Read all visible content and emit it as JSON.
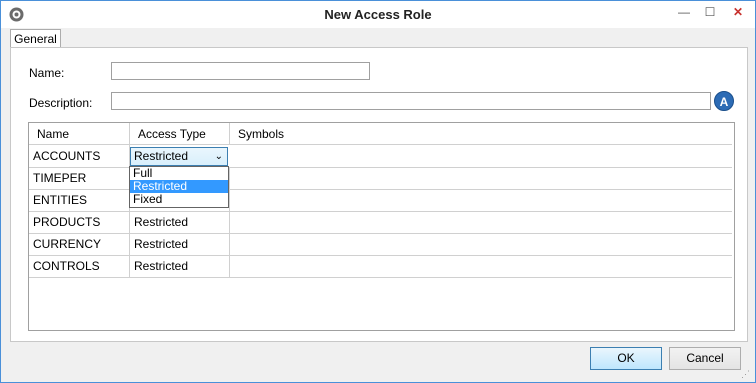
{
  "window": {
    "title": "New Access Role",
    "min_glyph": "—",
    "max_glyph": "☐",
    "close_glyph": "✕"
  },
  "tabs": [
    {
      "label": "General",
      "active": true
    }
  ],
  "form": {
    "name_label": "Name:",
    "name_value": "",
    "description_label": "Description:",
    "description_value": "",
    "description_button_glyph": "A"
  },
  "grid": {
    "columns": [
      "Name",
      "Access Type",
      "Symbols"
    ],
    "rows": [
      {
        "name": "ACCOUNTS",
        "access_type": "Restricted",
        "symbols": ""
      },
      {
        "name": "TIMEPER",
        "access_type": "",
        "symbols": ""
      },
      {
        "name": "ENTITIES",
        "access_type": "",
        "symbols": ""
      },
      {
        "name": "PRODUCTS",
        "access_type": "Restricted",
        "symbols": ""
      },
      {
        "name": "CURRENCY",
        "access_type": "Restricted",
        "symbols": ""
      },
      {
        "name": "CONTROLS",
        "access_type": "Restricted",
        "symbols": ""
      }
    ],
    "dropdown_options": [
      "Full",
      "Restricted",
      "Fixed"
    ],
    "dropdown_selected": "Restricted"
  },
  "buttons": {
    "ok": "OK",
    "cancel": "Cancel"
  },
  "colors": {
    "accent": "#3399ff",
    "window_border": "#4a90d9",
    "close": "#c7312d"
  }
}
